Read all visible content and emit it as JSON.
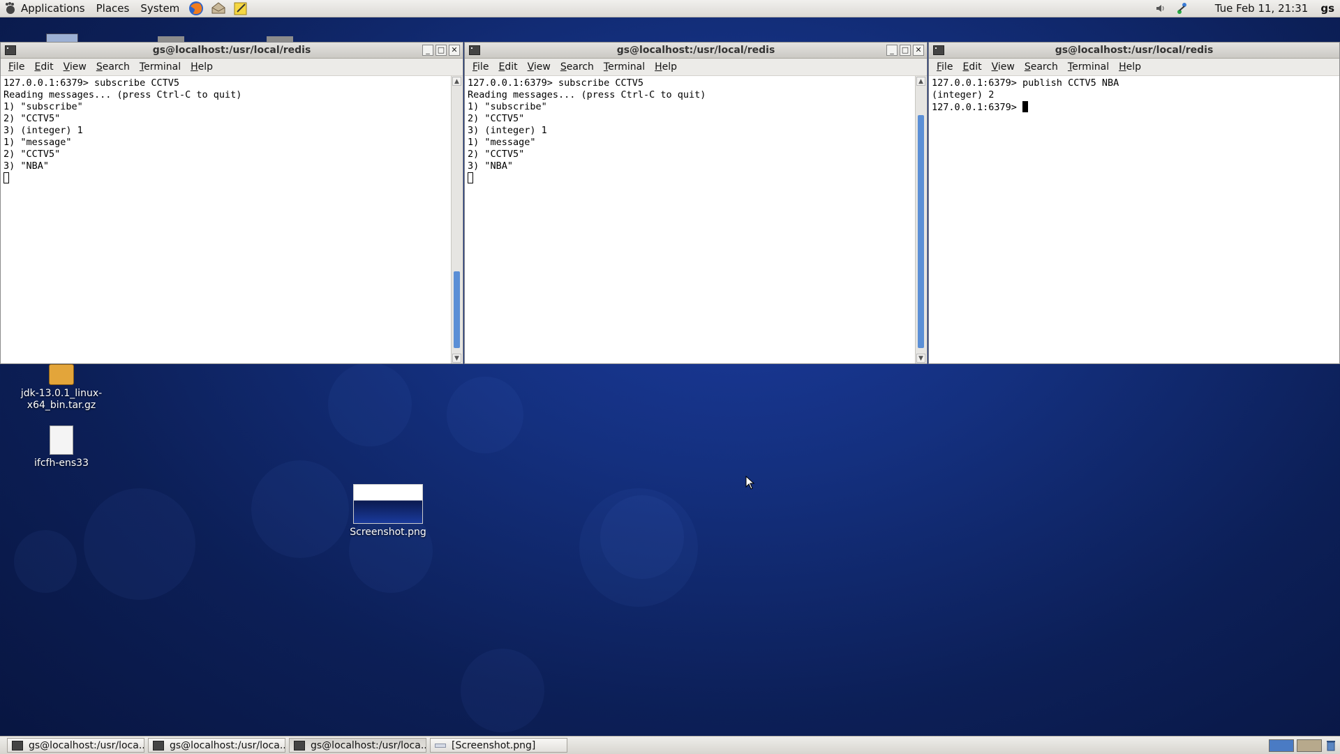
{
  "top_panel": {
    "menus": [
      "Applications",
      "Places",
      "System"
    ],
    "launchers": [
      "firefox-icon",
      "mail-icon",
      "notes-icon"
    ],
    "clock": "Tue Feb 11, 21:31",
    "user": "gs"
  },
  "desktop_icons": [
    {
      "name": "jdk-13.0.1_linux-x64_bin.tar.gz",
      "line1": "jdk-13.0.1_linux-",
      "line2": "x64_bin.tar.gz",
      "icon": "archive-icon"
    },
    {
      "name": "ifcfh-ens33",
      "line1": "ifcfh-ens33",
      "icon": "text-file-icon"
    },
    {
      "name": "Screenshot.png",
      "line1": "Screenshot.png",
      "icon": "image-thumbnail-icon"
    }
  ],
  "terminal_menu": [
    "File",
    "Edit",
    "View",
    "Search",
    "Terminal",
    "Help"
  ],
  "terminals": [
    {
      "title": "gs@localhost:/usr/local/redis",
      "lines": [
        "127.0.0.1:6379> subscribe CCTV5",
        "Reading messages... (press Ctrl-C to quit)",
        "1) \"subscribe\"",
        "2) \"CCTV5\"",
        "3) (integer) 1",
        "1) \"message\"",
        "2) \"CCTV5\"",
        "3) \"NBA\""
      ],
      "scroll_position": 0.82
    },
    {
      "title": "gs@localhost:/usr/local/redis",
      "lines": [
        "127.0.0.1:6379> subscribe CCTV5",
        "Reading messages... (press Ctrl-C to quit)",
        "1) \"subscribe\"",
        "2) \"CCTV5\"",
        "3) (integer) 1",
        "1) \"message\"",
        "2) \"CCTV5\"",
        "3) \"NBA\""
      ],
      "scroll_position": 0.9
    },
    {
      "title": "gs@localhost:/usr/local/redis",
      "lines": [
        "127.0.0.1:6379> publish CCTV5 NBA",
        "(integer) 2"
      ],
      "prompt": "127.0.0.1:6379> "
    }
  ],
  "taskbar": [
    {
      "label": "gs@localhost:/usr/loca...",
      "icon": "terminal-icon"
    },
    {
      "label": "gs@localhost:/usr/loca...",
      "icon": "terminal-icon"
    },
    {
      "label": "gs@localhost:/usr/loca...",
      "icon": "terminal-icon"
    },
    {
      "label": "[Screenshot.png]",
      "icon": "image-viewer-icon"
    }
  ]
}
